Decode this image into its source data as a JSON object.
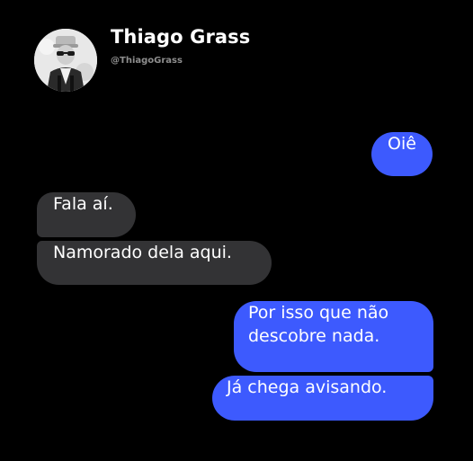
{
  "profile": {
    "name": "Thiago Grass",
    "handle": "@ThiagoGrass",
    "avatar_icon": "profile-photo"
  },
  "messages": [
    {
      "side": "sent",
      "text": "Oiê"
    },
    {
      "side": "received",
      "text": "Fala aí."
    },
    {
      "side": "received",
      "text": "Namorado dela aqui."
    },
    {
      "side": "sent",
      "lines": [
        "Por isso que não",
        "descobre nada."
      ]
    },
    {
      "side": "sent",
      "text": "Já chega avisando."
    }
  ],
  "colors": {
    "background": "#000000",
    "sent_bubble": "#3d5afe",
    "received_bubble": "#333335",
    "handle_text": "#8e8e8e"
  }
}
